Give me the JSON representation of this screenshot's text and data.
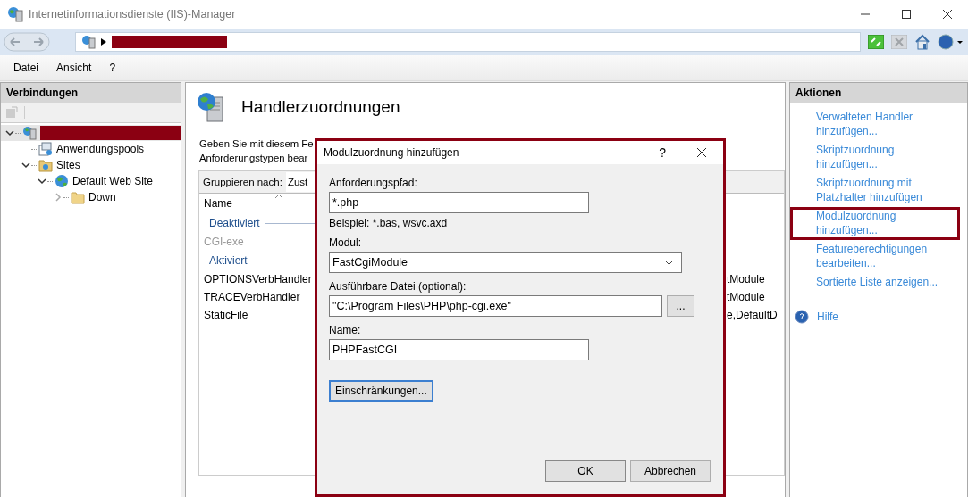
{
  "window": {
    "title": "Internetinformationsdienste (IIS)-Manager"
  },
  "menu": [
    {
      "label": "Datei"
    },
    {
      "label": "Ansicht"
    },
    {
      "label": "?"
    }
  ],
  "connections": {
    "title": "Verbindungen",
    "tree": [
      {
        "kind": "server",
        "selected": true,
        "expanded": true,
        "children": [
          {
            "kind": "pool",
            "label": "Anwendungspools",
            "selected": false
          },
          {
            "kind": "sites",
            "label": "Sites",
            "selected": false,
            "expanded": true,
            "children": [
              {
                "kind": "site",
                "label": "Default Web Site",
                "selected": false,
                "expanded": true,
                "children": [
                  {
                    "kind": "folder",
                    "label": "Down",
                    "selected": false,
                    "expanded": false
                  }
                ]
              }
            ]
          }
        ]
      }
    ]
  },
  "feature": {
    "title": "Handlerzuordnungen",
    "description": [
      "Geben Sie mit diesem Fe",
      "Anforderungstypen bear"
    ],
    "group_by": {
      "label": "Gruppieren nach:",
      "value": "Zust"
    },
    "columns": [
      "Name"
    ],
    "groups": [
      {
        "label": "Deaktiviert",
        "rows": [
          {
            "name": "CGI-exe",
            "disabled": true
          }
        ]
      },
      {
        "label": "Aktiviert",
        "rows": [
          {
            "name": "OPTIONSVerbHandler",
            "disabled": false,
            "column_3": "tModule"
          },
          {
            "name": "TRACEVerbHandler",
            "disabled": false,
            "column_3": "tModule"
          },
          {
            "name": "StaticFile",
            "disabled": false,
            "column_3": "e,DefaultD"
          }
        ]
      }
    ]
  },
  "actions": {
    "title": "Aktionen",
    "items": [
      {
        "kind": "link",
        "label": "Verwalteten Handler hinzufügen...",
        "annotated": false
      },
      {
        "kind": "link",
        "label": "Skriptzuordnung hinzufügen...",
        "annotated": false
      },
      {
        "kind": "link",
        "label": "Skriptzuordnung mit Platzhalter hinzufügen",
        "annotated": false
      },
      {
        "kind": "link",
        "label": "Modulzuordnung hinzufügen...",
        "annotated": true
      },
      {
        "kind": "link",
        "label": "Featureberechtigungen bearbeiten...",
        "annotated": false
      },
      {
        "kind": "link",
        "label": "Sortierte Liste anzeigen...",
        "annotated": false
      },
      {
        "kind": "help",
        "label": "Hilfe",
        "annotated": false
      }
    ]
  },
  "dialog": {
    "title": "Modulzuordnung hinzufügen",
    "help": "?",
    "fields": [
      {
        "kind": "text",
        "label": "Anforderungspfad:",
        "value": "*.php",
        "hint": "Beispiel: *.bas, wsvc.axd"
      },
      {
        "kind": "dropdown",
        "label": "Modul:",
        "value": "FastCgiModule"
      },
      {
        "kind": "file",
        "label": "Ausführbare Datei (optional):",
        "value": "\"C:\\Program Files\\PHP\\php-cgi.exe\"",
        "browse": "..."
      },
      {
        "kind": "text",
        "label": "Name:",
        "value": "PHPFastCGI"
      }
    ],
    "restrictions": "Einschränkungen...",
    "buttons": [
      {
        "label": "OK",
        "kind": "default"
      },
      {
        "label": "Abbrechen",
        "kind": "normal"
      }
    ]
  }
}
